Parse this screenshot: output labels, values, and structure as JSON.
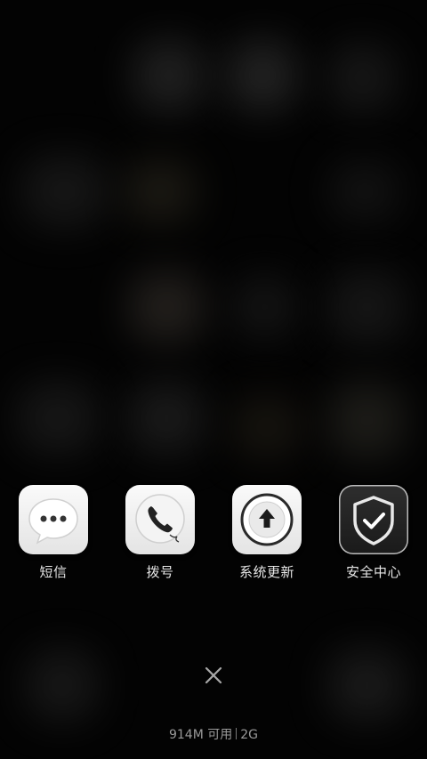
{
  "recent_apps": [
    {
      "label": "短信",
      "icon": "message-bubble-icon"
    },
    {
      "label": "拨号",
      "icon": "phone-handset-icon"
    },
    {
      "label": "系统更新",
      "icon": "upload-arrow-icon"
    },
    {
      "label": "安全中心",
      "icon": "shield-check-icon"
    }
  ],
  "close_all": {
    "icon": "close-icon"
  },
  "memory": {
    "available": "914M 可用",
    "total": "2G"
  }
}
